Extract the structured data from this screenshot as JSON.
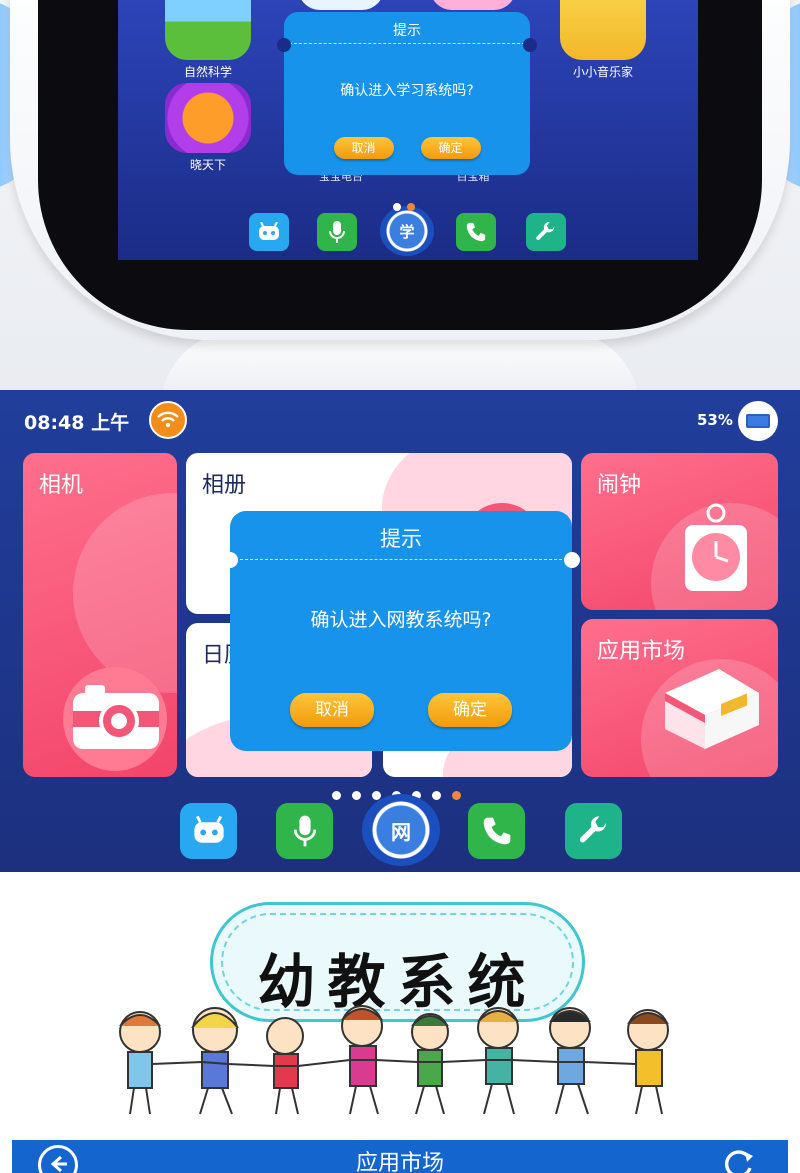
{
  "robot_screen": {
    "apps": [
      {
        "label": "自然科学",
        "icon": "nature-science-icon"
      },
      {
        "label": "晓天下",
        "icon": "planet-icon"
      },
      {
        "label": "小小音乐家",
        "icon": "music-birds-icon"
      },
      {
        "label": "宝宝电台",
        "icon": "panda-radio-icon"
      },
      {
        "label": "百宝箱",
        "icon": "treasure-box-icon"
      }
    ],
    "dialog": {
      "title": "提示",
      "message": "确认进入学习系统吗?",
      "cancel": "取消",
      "confirm": "确定"
    },
    "dock_center_label": "学",
    "page_dots": 2,
    "active_dot": 1
  },
  "launcher": {
    "status": {
      "time": "08:48 上午",
      "battery": "53%"
    },
    "tiles": {
      "camera": "相机",
      "album": "相册",
      "alarm": "闹钟",
      "calendar": "日历",
      "market": "应用市场"
    },
    "dialog": {
      "title": "提示",
      "message": "确认进入网教系统吗?",
      "cancel": "取消",
      "confirm": "确定"
    },
    "dock_center_label": "网",
    "page_dots": 7,
    "active_dot": 6
  },
  "banner": {
    "title": "幼教系统"
  },
  "market_bar": {
    "title": "应用市场",
    "back_icon": "back-arrow-icon",
    "refresh_icon": "refresh-icon"
  },
  "colors": {
    "dialog_blue": "#1793ec",
    "button_orange": "#f29b0c",
    "screen_blue": "#213e9c",
    "tile_pink": "#f2456a",
    "bar_blue": "#1565cf"
  }
}
